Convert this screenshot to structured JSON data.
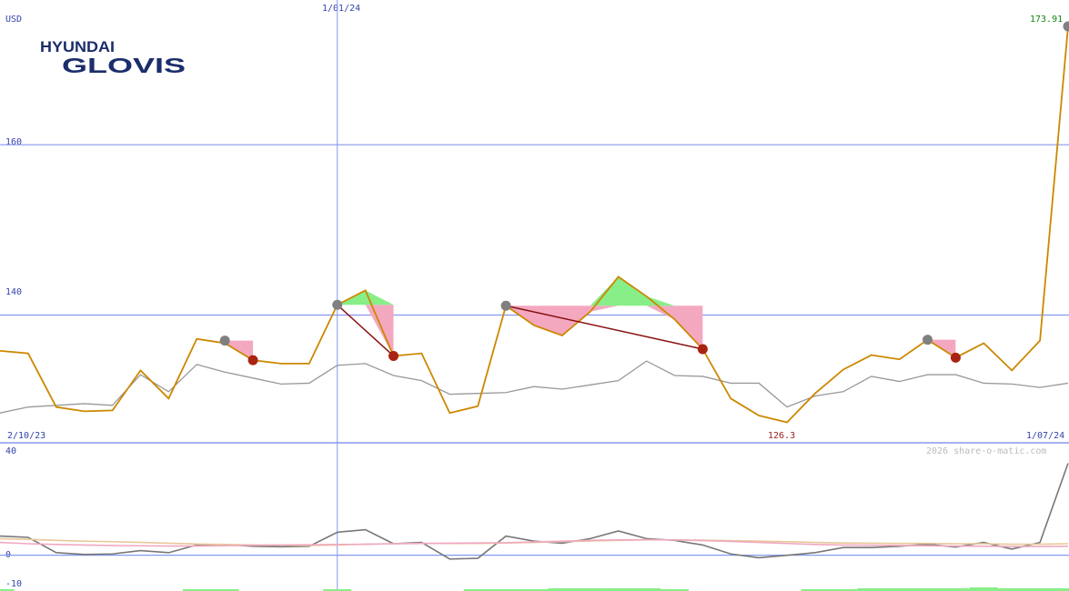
{
  "header": {
    "currency": "USD",
    "last_price_label": "173.91",
    "divider_date_label": "1/01/24",
    "start_date_label": "2/10/23",
    "end_date_label": "1/07/24",
    "low_label": "126.3",
    "watermark": "2026 share-o-matic.com"
  },
  "logo": {
    "line1": "HYUNDAI",
    "line2": "GLOVIS"
  },
  "colors": {
    "price": "#cc8800",
    "average": "#999999",
    "grid": "#8899ee",
    "label": "#3344aa",
    "last_price": "#118811",
    "low": "#992222",
    "peak_marker": "#808080",
    "trough_marker": "#aa2211",
    "trend_line": "#881111",
    "fill_down": "#f4a8c0",
    "fill_up": "#88ee88"
  },
  "chart_data": [
    {
      "type": "line",
      "ylim": [
        125,
        177
      ],
      "ytick_labels": [
        "160",
        "140"
      ],
      "ytick_values": [
        160,
        140
      ],
      "x_count": 38,
      "series": [
        {
          "values": [
            135.8,
            135.5,
            129.2,
            128.7,
            128.8,
            133.5,
            130.2,
            137.2,
            136.7,
            134.7,
            134.3,
            134.3,
            141.2,
            142.9,
            135.2,
            135.5,
            128.5,
            129.3,
            141.1,
            138.8,
            137.6,
            140.4,
            144.5,
            142.2,
            139.5,
            136.0,
            130.2,
            128.2,
            127.4,
            130.8,
            133.6,
            135.3,
            134.8,
            137.1,
            135.0,
            136.7,
            133.5,
            137.0,
            173.91
          ]
        },
        {
          "values": [
            128.5,
            129.2,
            129.4,
            129.6,
            129.4,
            133.0,
            131.0,
            134.2,
            133.3,
            132.6,
            131.9,
            132.0,
            134.1,
            134.3,
            132.9,
            132.3,
            130.7,
            130.8,
            130.9,
            131.6,
            131.3,
            131.8,
            132.3,
            134.6,
            132.9,
            132.8,
            132.0,
            132.0,
            129.2,
            130.5,
            131.0,
            132.8,
            132.2,
            133.0,
            133.0,
            132.0,
            131.9,
            131.5,
            132.0
          ]
        }
      ],
      "markers": {
        "peaks": [
          [
            8,
            137.0
          ],
          [
            12,
            141.2
          ],
          [
            18,
            141.1
          ],
          [
            33,
            137.1
          ]
        ],
        "troughs": [
          [
            9,
            134.7
          ],
          [
            14,
            135.2
          ],
          [
            25,
            136.0
          ],
          [
            34,
            135.0
          ]
        ]
      },
      "trend_lines": [
        [
          [
            12,
            141.2
          ],
          [
            14,
            135.2
          ]
        ],
        [
          [
            18,
            141.1
          ],
          [
            25,
            136.0
          ]
        ]
      ]
    },
    {
      "type": "line",
      "ylim": [
        -14,
        44
      ],
      "ytick_labels": [
        "40",
        "0",
        "-10"
      ],
      "ytick_values": [
        40,
        0,
        -10
      ],
      "series": [
        {
          "values": [
            7.5,
            7,
            1,
            0.3,
            0.5,
            1.8,
            1,
            4,
            4.2,
            3.5,
            3.3,
            3.5,
            9,
            10,
            4.5,
            5,
            -1.5,
            -1.2,
            7.5,
            5.5,
            4.7,
            6.5,
            9.5,
            6.5,
            5.8,
            4,
            0.5,
            -1,
            0,
            1,
            3,
            3,
            3.5,
            4.3,
            3.2,
            5,
            2.4,
            5,
            36
          ]
        },
        {
          "values": [
            6.5,
            6.2,
            5.8,
            5.5,
            5.3,
            5,
            4.7,
            4.4,
            4.2,
            4,
            3.9,
            3.8,
            4,
            4.3,
            4.5,
            4.6,
            4.6,
            4.6,
            4.8,
            5,
            5.3,
            5.6,
            5.8,
            6,
            6,
            5.9,
            5.7,
            5.5,
            5.3,
            5,
            4.8,
            4.7,
            4.6,
            4.6,
            4.5,
            4.5,
            4.3,
            4.3,
            4.5
          ]
        },
        {
          "values": [
            5,
            4.5,
            4.2,
            4,
            3.8,
            3.7,
            3.6,
            3.6,
            3.7,
            3.9,
            4,
            4.1,
            4.2,
            4.3,
            4.5,
            4.6,
            4.7,
            4.8,
            4.9,
            5.2,
            5.5,
            5.8,
            6,
            6.1,
            6,
            5.7,
            5.4,
            5,
            4.6,
            4.2,
            4,
            3.9,
            3.8,
            3.7,
            3.6,
            3.5,
            3.4,
            3.4,
            3.5
          ]
        }
      ],
      "bars": {
        "values": [
          2,
          0,
          0,
          0,
          0,
          0,
          0,
          2,
          2,
          0,
          0,
          0,
          2,
          0,
          0,
          0,
          0,
          2,
          2,
          2,
          3,
          3,
          3,
          3,
          2,
          0,
          0,
          0,
          0,
          2,
          2,
          3,
          3,
          3,
          3,
          4,
          3,
          3,
          3
        ],
        "ylim_max": 40
      }
    }
  ]
}
